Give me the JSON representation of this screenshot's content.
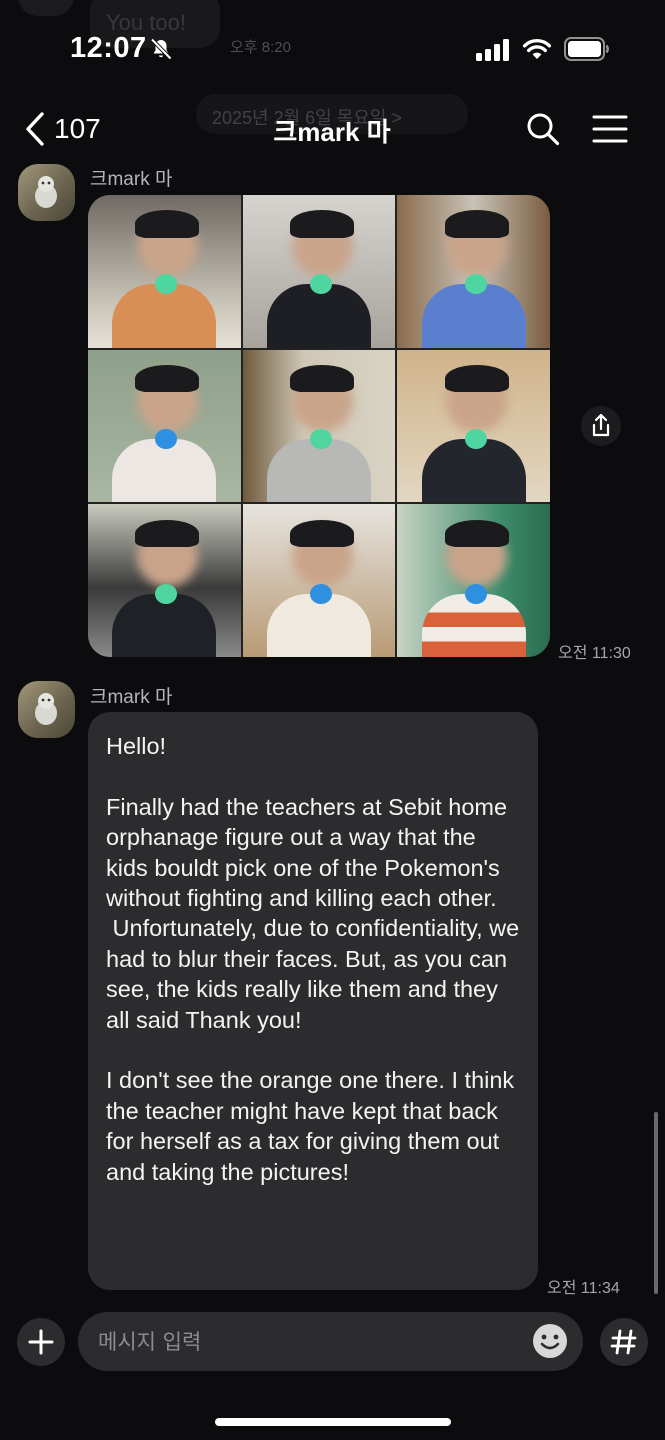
{
  "status_bar": {
    "time": "12:07"
  },
  "previous": {
    "message": "You too!",
    "time": "오후 8:20",
    "date_chip": "2025년 2월 6일 목요일 >"
  },
  "header": {
    "back_count": "107",
    "title": "크mark 마"
  },
  "messages": [
    {
      "sender": "크mark 마",
      "type": "photo-collage",
      "time": "오전 11:30"
    },
    {
      "sender": "크mark 마",
      "type": "text",
      "text": "Hello!\n\nFinally had the teachers at Sebit home orphanage figure out a way that the kids bouldt pick one of the Pokemon's without fighting and killing each other.\n Unfortunately, due to confidentiality, we had to blur their faces. But, as you can see, the kids really like them and they all said Thank you!\n\nI don't see the orange one there. I think the teacher might have kept that back for herself as a tax for giving them out and taking the pictures!",
      "time": "오전 11:34"
    }
  ],
  "composer": {
    "placeholder": "메시지 입력"
  },
  "colors": {
    "background": "#0c0c0e",
    "bubble": "#2c2c2e",
    "toy_green": "#4fd6a0",
    "toy_blue": "#2f8fe0"
  }
}
